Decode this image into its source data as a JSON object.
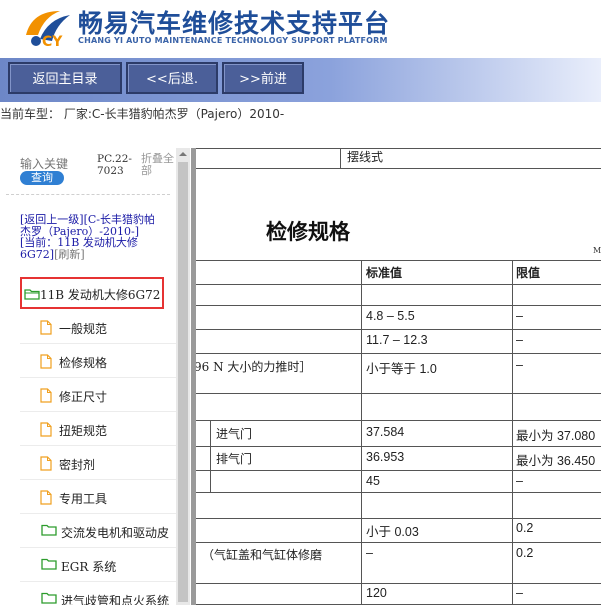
{
  "brand": {
    "title": "畅易汽车维修技术支持平台",
    "subtitle": "CHANG YI AUTO MAINTENANCE TECHNOLOGY SUPPORT PLATFORM"
  },
  "toolbar": {
    "home_label": "返回主目录",
    "back_label": "<<后退.",
    "forward_label": ">>前进"
  },
  "car_line": "当前车型： 厂家:C-长丰猎豹帕杰罗（Pajero）2010-",
  "nav": {
    "search_placeholder": "输入关键",
    "search_button": "查询",
    "pc_code": "PC.22-7023",
    "collapse_all": "折叠全部",
    "crumb_up": "[返回上一级]",
    "crumb_parent": "[C-长丰猎豹帕杰罗（Pajero）-2010-]",
    "crumb_current": "[当前：11B 发动机大修6G72]",
    "crumb_refresh": "[刷新]",
    "current_node": "11B 发动机大修6G72",
    "items": [
      "一般规范",
      "检修规格",
      "修正尺寸",
      "扭矩规范",
      "密封剂",
      "专用工具",
      "交流发电机和驱动皮",
      "EGR 系统",
      "进气歧管和点火系统"
    ]
  },
  "content": {
    "pendulum": "摆线式",
    "title": "检修规格",
    "unit_hint": "M",
    "headers": {
      "standard": "标准值",
      "limit": "限值"
    },
    "rows": [
      {
        "standard": "4.8 – 5.5",
        "limit": "–"
      },
      {
        "standard": "11.7 – 12.3",
        "limit": "–"
      },
      {
        "item": "96 N 大小的力推时］",
        "standard": "小于等于 1.0",
        "limit": "–"
      },
      {
        "item": "进气门",
        "standard": "37.584",
        "limit": "最小为 37.080"
      },
      {
        "item": "排气门",
        "standard": "36.953",
        "limit": "最小为 36.450"
      },
      {
        "standard": "45",
        "limit": "–"
      },
      {
        "standard": "小于 0.03",
        "limit": "0.2"
      },
      {
        "item": "（气缸盖和气缸体修磨",
        "standard": "–",
        "limit": "0.2"
      },
      {
        "standard": "120",
        "limit": "–"
      }
    ]
  },
  "colors": {
    "brand_blue": "#1f4e99",
    "highlight_red": "#e63333",
    "toolbar_button": "#4b5f99",
    "search_button": "#2f7fd3"
  }
}
